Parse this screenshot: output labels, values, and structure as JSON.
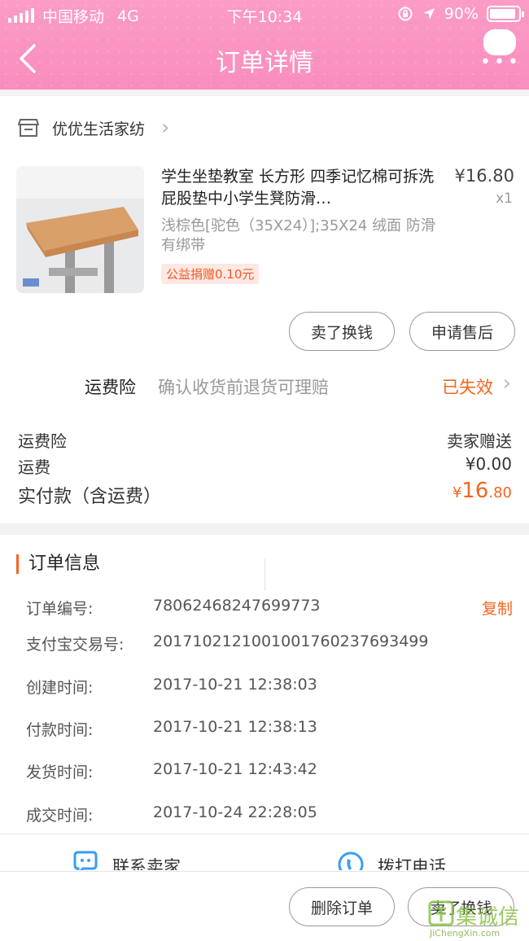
{
  "status_bar": {
    "carrier": "中国移动",
    "network": "4G",
    "time": "下午10:34",
    "battery": "90%",
    "battery_level": 0.9
  },
  "nav": {
    "title": "订单详情"
  },
  "shop": {
    "name": "优优生活家纺"
  },
  "product": {
    "title": "学生坐垫教室 长方形 四季记忆棉可拆洗屁股垫中小学生凳防滑…",
    "price": "¥16.80",
    "qty": "x1",
    "sku": "浅棕色[驼色（35X24）];35X24 绒面 防滑 有绑带",
    "tag": "公益捐赠0.10元"
  },
  "actions": {
    "sell": "卖了换钱",
    "after_sale": "申请售后"
  },
  "insurance": {
    "label": "运费险",
    "desc": "确认收货前退货可理赔",
    "status": "已失效"
  },
  "fees": {
    "ins_label": "运费险",
    "ins_value": "卖家赠送",
    "ship_label": "运费",
    "ship_value": "¥0.00",
    "paid_label": "实付款（含运费）",
    "paid_symbol": "¥",
    "paid_int": "16",
    "paid_dec": ".80"
  },
  "order_info": {
    "title": "订单信息",
    "rows": [
      {
        "k": "订单编号:",
        "v": "78062468247699773"
      },
      {
        "k": "支付宝交易号:",
        "v": "2017102121001001760237693499"
      },
      {
        "k": "创建时间:",
        "v": "2017-10-21 12:38:03"
      },
      {
        "k": "付款时间:",
        "v": "2017-10-21 12:38:13"
      },
      {
        "k": "发货时间:",
        "v": "2017-10-21 12:43:42"
      },
      {
        "k": "成交时间:",
        "v": "2017-10-24 22:28:05"
      }
    ],
    "copy": "复制"
  },
  "contact": {
    "seller": "联系卖家",
    "phone": "拨打电话"
  },
  "bottom": {
    "delete": "删除订单",
    "sell": "卖了换钱"
  },
  "watermark": {
    "text": "集诚信",
    "url": "JiChengXin.com"
  },
  "colors": {
    "header_pink": "#f98dbe",
    "accent_orange": "#f5651e"
  }
}
